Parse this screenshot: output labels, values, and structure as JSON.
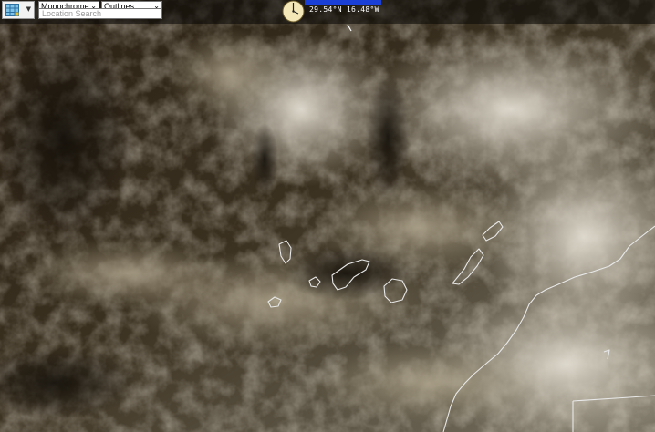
{
  "toolbar": {
    "layers_icon": "grid-icon",
    "mode_select": {
      "selected": "Monochrome"
    },
    "overlay_select": {
      "selected": "Outlines"
    },
    "search": {
      "value": "",
      "placeholder": "Location Search"
    }
  },
  "status": {
    "coordinates": "29.54°N 16.48°W"
  },
  "colors": {
    "accent_blue": "#1a3fd6",
    "outline": "#e8e8e8",
    "compass_face": "#f3e7b8"
  }
}
